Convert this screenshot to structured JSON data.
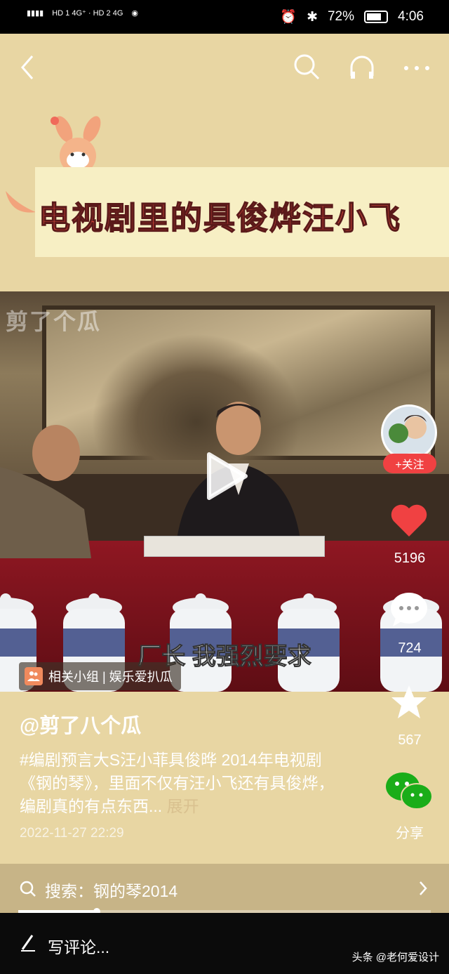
{
  "status_bar": {
    "network_left": "HD 1 4G⁺ · HD 2 4G",
    "battery": "72%",
    "time": "4:06"
  },
  "nav": {
    "back_icon": "chevron-left-icon",
    "search_icon": "search-icon",
    "listen_icon": "headphones-icon",
    "more_icon": "more-icon"
  },
  "banner": {
    "title": "电视剧里的具俊烨汪小飞"
  },
  "video": {
    "watermark": "剪了个瓜",
    "subtitle": "厂长 我强烈要求",
    "group_tag": "相关小组 | 娱乐爱扒瓜"
  },
  "post": {
    "author": "@剪了八个瓜",
    "description": "#编剧预言大S汪小菲具俊晔 2014年电视剧《钢的琴》，里面不仅有汪小飞还有具俊烨，编剧真的有点东西... ",
    "expand": "展开",
    "date": "2022-11-27 22:29"
  },
  "actions": {
    "follow": "+关注",
    "likes": "5196",
    "comments": "724",
    "favorites": "567",
    "share": "分享"
  },
  "search": {
    "label": "搜索：钢的琴2014",
    "progress": 0.19
  },
  "comment_bar": {
    "placeholder": "写评论...",
    "brand": "头条 @老何爱设计"
  },
  "colors": {
    "background": "#e8d6a3",
    "like": "#f04142",
    "follow": "#f04142",
    "share": "#1aad19",
    "banner_text": "#e34b3d"
  }
}
